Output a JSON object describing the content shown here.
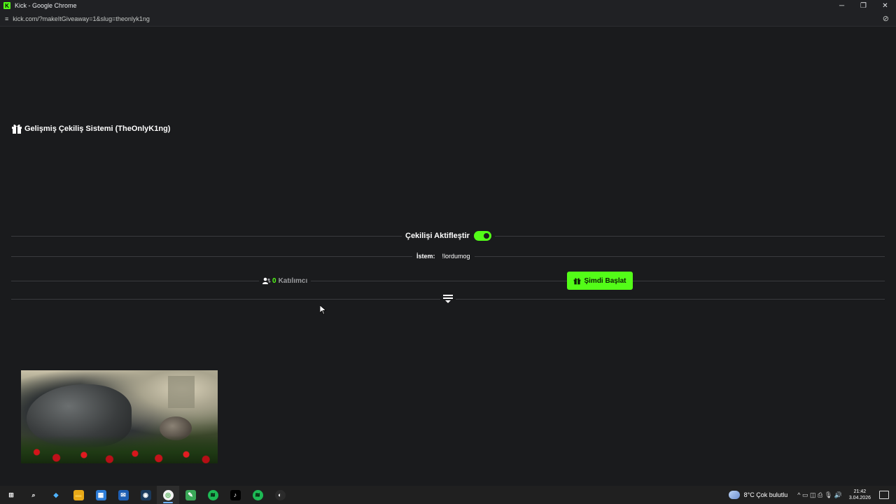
{
  "window": {
    "title": "Kick - Google Chrome",
    "logo_letter": "K",
    "minimize": "─",
    "restore": "❐",
    "close": "✕"
  },
  "browser": {
    "url": "kick.com/?makeItGiveaway=1&slug=theonlyk1ng",
    "site_settings_icon": "≡",
    "tracking_icon": "⊘"
  },
  "page": {
    "title": "Gelişmiş Çekiliş Sistemi (TheOnlyK1ng)",
    "activate_label": "Çekilişi Aktifleştir",
    "toggle_on": true,
    "command_label": "İstem:",
    "command_value": "!lordumog",
    "participants_count": "0",
    "participants_label": "Katılımcı",
    "start_button": "Şimdi Başlat"
  },
  "taskbar": {
    "apps": [
      {
        "name": "start",
        "glyph": "⊞",
        "color": "#ffffff",
        "bg": "transparent"
      },
      {
        "name": "search",
        "glyph": "⌕",
        "color": "#ffffff",
        "bg": "transparent"
      },
      {
        "name": "copilot",
        "glyph": "◆",
        "color": "#4fb3ff",
        "bg": "transparent"
      },
      {
        "name": "file-explorer",
        "glyph": "▬",
        "color": "#f4c542",
        "bg": "#e8a917"
      },
      {
        "name": "ms-store",
        "glyph": "▦",
        "color": "#ffffff",
        "bg": "#2d7cd6"
      },
      {
        "name": "mail",
        "glyph": "✉",
        "color": "#ffffff",
        "bg": "#1e5fb4"
      },
      {
        "name": "steam",
        "glyph": "◉",
        "color": "#ffffff",
        "bg": "#1b3a5c"
      },
      {
        "name": "chrome",
        "glyph": "◎",
        "color": "#4caf50",
        "bg": "#f2f2f2",
        "active": true
      },
      {
        "name": "notepad",
        "glyph": "✎",
        "color": "#ffffff",
        "bg": "#3aa757"
      },
      {
        "name": "spotify",
        "glyph": "≋",
        "color": "#000000",
        "bg": "#1db954"
      },
      {
        "name": "tiktok",
        "glyph": "♪",
        "color": "#ffffff",
        "bg": "#000000"
      },
      {
        "name": "spotify-2",
        "glyph": "≋",
        "color": "#000000",
        "bg": "#1db954"
      },
      {
        "name": "obs",
        "glyph": "◐",
        "color": "#ffffff",
        "bg": "#2b2b2b"
      }
    ],
    "weather": "8°C  Çok bulutlu",
    "tray_icons": "^  ▭  ◫  ⎙  🎙  🔊",
    "time": "21:42",
    "date": "3.04.2026"
  }
}
